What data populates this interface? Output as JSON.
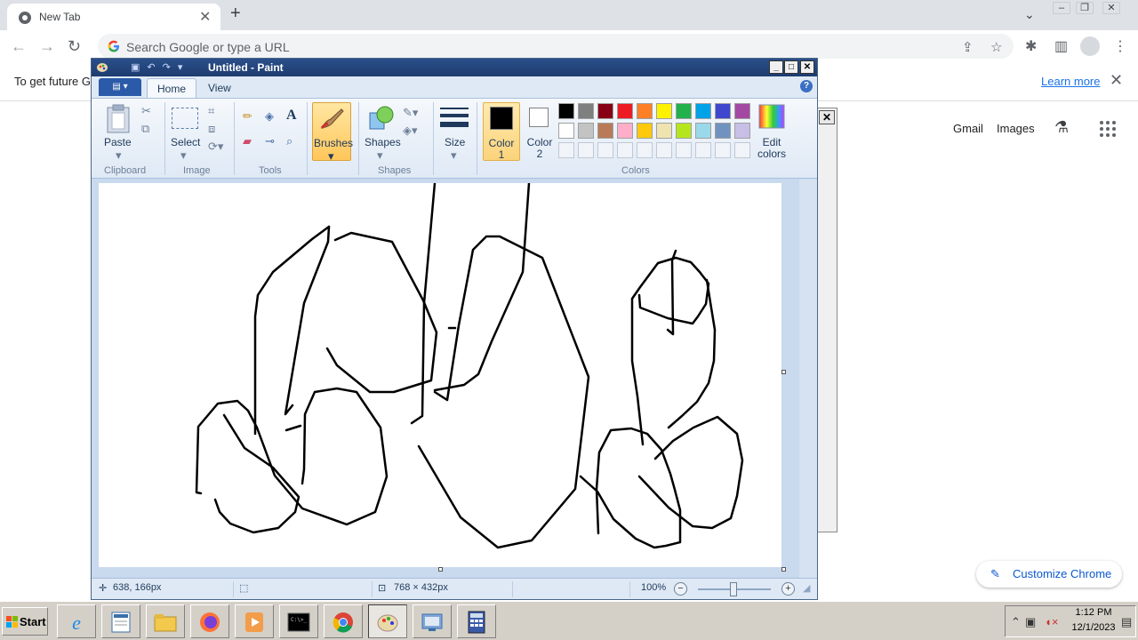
{
  "browser": {
    "tab_title": "New Tab",
    "new_tab_glyph": "+",
    "close_glyph": "✕",
    "omnibox_placeholder": "Search Google or type a URL",
    "info_text": "To get future Go",
    "learn_more": "Learn more",
    "links": {
      "gmail": "Gmail",
      "images": "Images"
    },
    "customize_label": "Customize Chrome",
    "accent_color": "#1a73e8"
  },
  "paint": {
    "title": "Untitled - Paint",
    "tabs": [
      {
        "label": "Home"
      },
      {
        "label": "View"
      }
    ],
    "groups": {
      "clipboard": "Clipboard",
      "image": "Image",
      "tools": "Tools",
      "shapes": "Shapes",
      "colors": "Colors"
    },
    "buttons": {
      "paste": "Paste",
      "select": "Select",
      "brushes": "Brushes",
      "shapes": "Shapes",
      "size": "Size",
      "color1_line1": "Color",
      "color1_line2": "1",
      "color2_line1": "Color",
      "color2_line2": "2",
      "edit_colors_line1": "Edit",
      "edit_colors_line2": "colors"
    },
    "color1": "#000000",
    "color2": "#ffffff",
    "palette": [
      "#000000",
      "#7f7f7f",
      "#880015",
      "#ed1c24",
      "#ff7f27",
      "#fff200",
      "#22b14c",
      "#00a2e8",
      "#3f48cc",
      "#a349a4",
      "#ffffff",
      "#c3c3c3",
      "#b97a57",
      "#ffaec9",
      "#ffc90e",
      "#efe4b0",
      "#b5e61d",
      "#99d9ea",
      "#7092be",
      "#c8bfe7"
    ],
    "status": {
      "cursor_pos": "638, 166px",
      "canvas_size": "768 × 432px",
      "zoom": "100%"
    }
  },
  "taskbar": {
    "start_label": "Start",
    "apps": [
      {
        "name": "internet-explorer"
      },
      {
        "name": "wordpad"
      },
      {
        "name": "file-explorer"
      },
      {
        "name": "firefox"
      },
      {
        "name": "media-player"
      },
      {
        "name": "command-prompt"
      },
      {
        "name": "chrome"
      },
      {
        "name": "paint"
      },
      {
        "name": "network-settings"
      },
      {
        "name": "calculator"
      }
    ],
    "clock_time": "1:12 PM",
    "clock_date": "12/1/2023"
  }
}
